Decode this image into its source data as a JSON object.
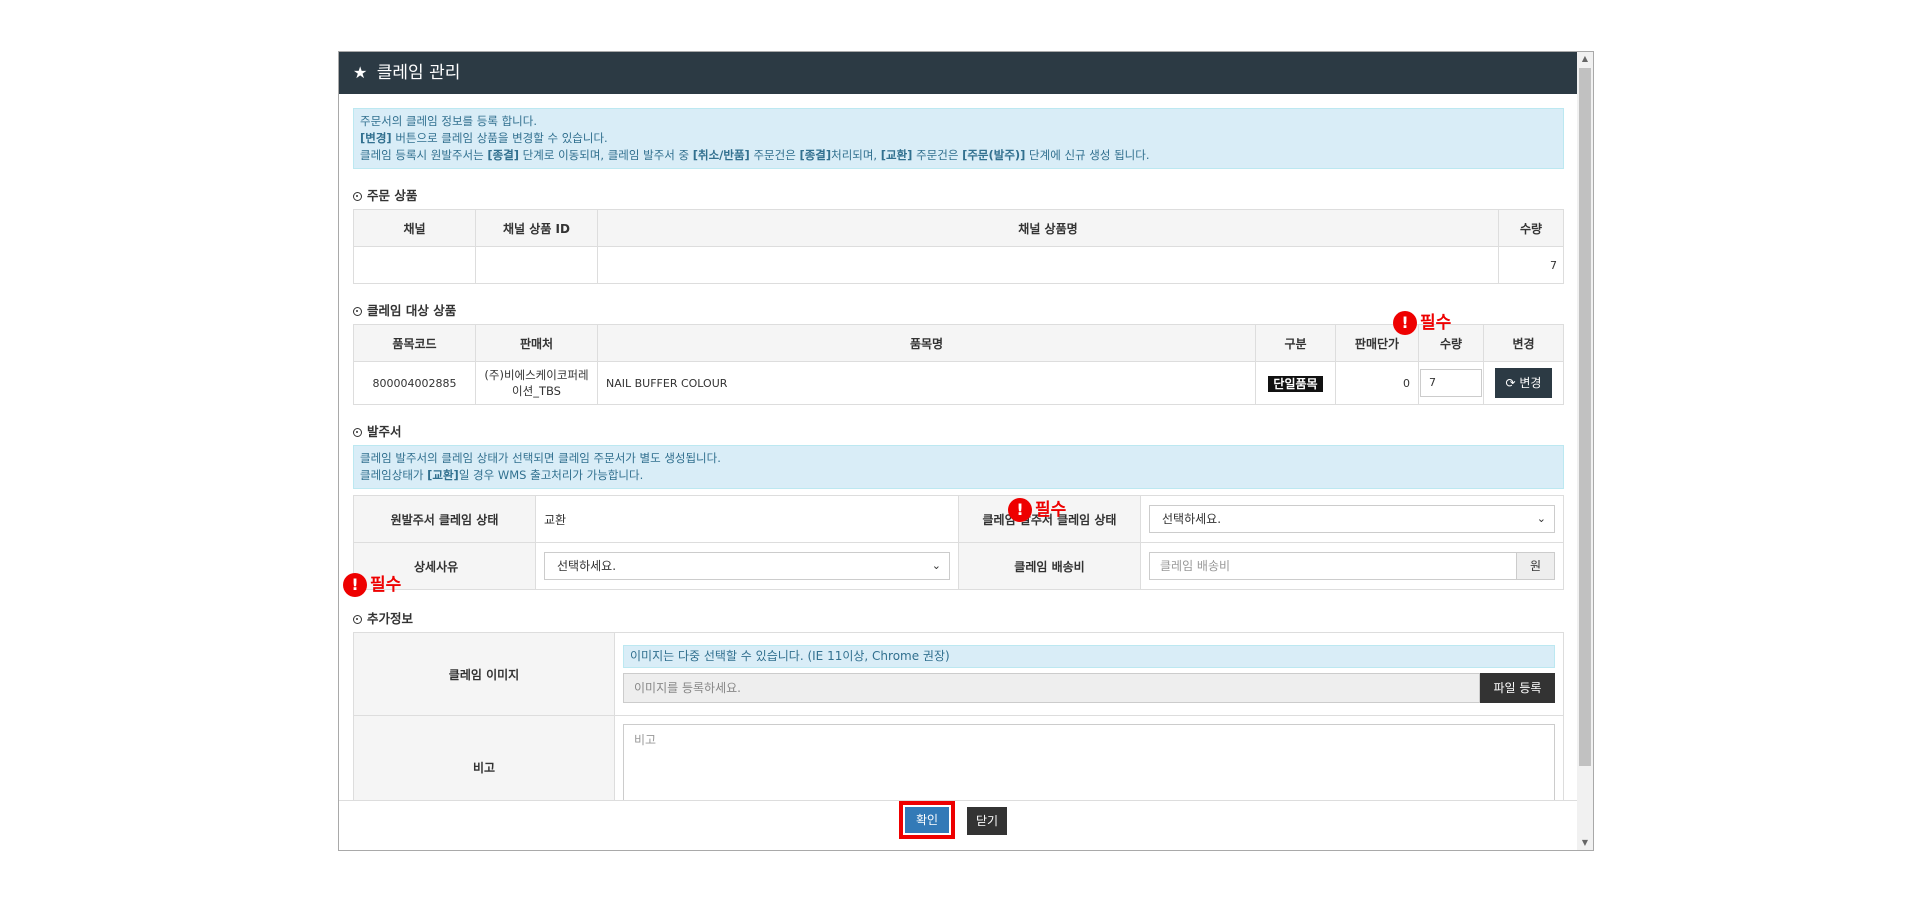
{
  "header": {
    "title": "클레임 관리"
  },
  "intro_note": {
    "line1": "주문서의 클레임 정보를 등록 합니다.",
    "line2_b": "[변경]",
    "line2": " 버튼으로 클레임 상품을 변경할 수 있습니다.",
    "line3_a": "클레임 등록시 원발주서는 ",
    "line3_b1": "[종결]",
    "line3_c": " 단계로 이동되며, 클레임 발주서 중 ",
    "line3_b2": "[취소/반품]",
    "line3_d": " 주문건은 ",
    "line3_b3": "[종결]",
    "line3_e": "처리되며, ",
    "line3_b4": "[교환]",
    "line3_f": " 주문건은 ",
    "line3_b5": "[주문(발주)]",
    "line3_g": " 단계에 신규 생성 됩니다."
  },
  "order_items": {
    "title": "주문 상품",
    "headers": [
      "채널",
      "채널 상품 ID",
      "채널 상품명",
      "수량"
    ],
    "rows": [
      [
        "",
        "",
        "",
        "7"
      ]
    ]
  },
  "claim_items": {
    "title": "클레임 대상 상품",
    "headers": [
      "품목코드",
      "판매처",
      "품목명",
      "구분",
      "판매단가",
      "수량",
      "변경"
    ],
    "row": {
      "code": "800004002885",
      "seller": "(주)비에스케이코퍼레이션_TBS",
      "name": "NAIL BUFFER COLOUR",
      "type": "단일품목",
      "price": "0",
      "qty": "7",
      "change_btn": "변경"
    }
  },
  "required_label": "필수",
  "purchase_order": {
    "title": "발주서",
    "note_line1": "클레임 발주서의 클레임 상태가 선택되면 클레임 주문서가 별도 생성됩니다.",
    "note_line2_a": "클레임상태가 ",
    "note_line2_b": "[교환]",
    "note_line2_c": "일 경우 WMS 출고처리가 가능합니다.",
    "orig_status_label": "원발주서 클레임 상태",
    "orig_status_value": "교환",
    "claim_status_label": "클레임 발주서 클레임 상태",
    "claim_status_value": "선택하세요.",
    "reason_label": "상세사유",
    "reason_value": "선택하세요.",
    "shipping_label": "클레임 배송비",
    "shipping_placeholder": "클레임 배송비",
    "shipping_unit": "원"
  },
  "extra_info": {
    "title": "추가정보",
    "image_label": "클레임 이미지",
    "image_note": "이미지는 다중 선택할 수 있습니다. (IE 11이상, Chrome 권장)",
    "image_placeholder": "이미지를 등록하세요.",
    "file_btn": "파일 등록",
    "memo_label": "비고",
    "memo_placeholder": "비고"
  },
  "footer": {
    "ok": "확인",
    "close": "닫기"
  },
  "colors": {
    "header_bg": "#2c3a44",
    "note_bg": "#d9edf7",
    "note_text": "#31708f",
    "required": "#e00000",
    "ok_btn": "#337ab7"
  }
}
